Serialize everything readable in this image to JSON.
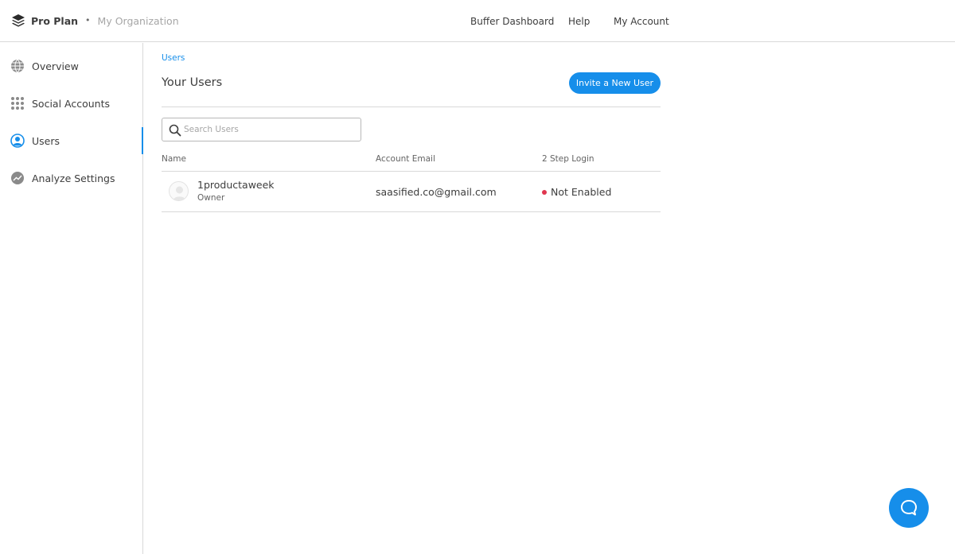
{
  "header": {
    "plan": "Pro Plan",
    "separator": "•",
    "organization": "My Organization",
    "nav": [
      "Buffer Dashboard",
      "Help",
      "My Account"
    ]
  },
  "sidebar": {
    "items": [
      {
        "label": "Overview",
        "icon": "globe-icon"
      },
      {
        "label": "Social Accounts",
        "icon": "grid-icon"
      },
      {
        "label": "Users",
        "icon": "user-circle-icon",
        "active": true
      },
      {
        "label": "Analyze Settings",
        "icon": "analytics-icon"
      }
    ]
  },
  "main": {
    "breadcrumb": "Users",
    "title": "Your Users",
    "invite_label": "Invite a New User",
    "search_placeholder": "Search Users",
    "columns": [
      "Name",
      "Account Email",
      "2 Step Login"
    ],
    "users": [
      {
        "name": "1productaweek",
        "role": "Owner",
        "email": "saasified.co@gmail.com",
        "two_step": "Not Enabled"
      }
    ]
  },
  "colors": {
    "accent": "#168eea",
    "status_disabled": "#e0364f"
  }
}
